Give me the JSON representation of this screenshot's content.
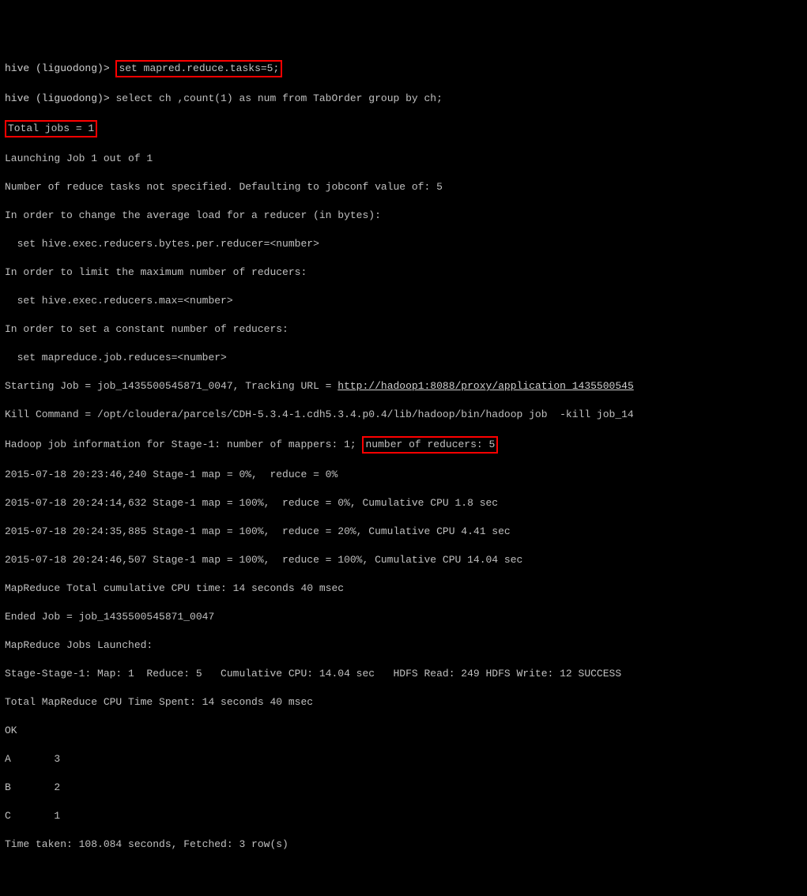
{
  "prompt": "hive (liguodong)>",
  "cmd1": "set mapred.reduce.tasks=5;",
  "cmd2": "select ch ,count(1) as num from TabOrder group by ch;",
  "total_jobs": "Total jobs = 1",
  "lines": {
    "launch": "Launching Job 1 out of 1",
    "nspec": "Number of reduce tasks not specified. Defaulting to jobconf value of: 5",
    "avg": "In order to change the average load for a reducer (in bytes):",
    "avg2": "  set hive.exec.reducers.bytes.per.reducer=<number>",
    "lim": "In order to limit the maximum number of reducers:",
    "lim2": "  set hive.exec.reducers.max=<number>",
    "const": "In order to set a constant number of reducers:",
    "const2": "  set mapreduce.job.reduces=<number>",
    "startjob_pre": "Starting Job = job_1435500545871_0047, Tracking URL = ",
    "tracking_url": "http://hadoop1:8088/proxy/application_1435500545",
    "kill": "Kill Command = /opt/cloudera/parcels/CDH-5.3.4-1.cdh5.3.4.p0.4/lib/hadoop/bin/hadoop job  -kill job_14",
    "jobinfo_pre": "Hadoop job information for Stage-1: number of mappers: 1; ",
    "reducers_box": "number of reducers: 5",
    "p0": "2015-07-18 20:23:46,240 Stage-1 map = 0%,  reduce = 0%",
    "p1": "2015-07-18 20:24:14,632 Stage-1 map = 100%,  reduce = 0%, Cumulative CPU 1.8 sec",
    "p2": "2015-07-18 20:24:35,885 Stage-1 map = 100%,  reduce = 20%, Cumulative CPU 4.41 sec",
    "p3": "2015-07-18 20:24:46,507 Stage-1 map = 100%,  reduce = 100%, Cumulative CPU 14.04 sec",
    "cpu_total": "MapReduce Total cumulative CPU time: 14 seconds 40 msec",
    "ended": "Ended Job = job_1435500545871_0047",
    "mr_launched": "MapReduce Jobs Launched:",
    "stage_stats": "Stage-Stage-1: Map: 1  Reduce: 5   Cumulative CPU: 14.04 sec   HDFS Read: 249 HDFS Write: 12 SUCCESS",
    "cpu_spent": "Total MapReduce CPU Time Spent: 14 seconds 40 msec",
    "ok": "OK",
    "time_taken": "Time taken: 108.084 seconds, Fetched: 3 row(s)"
  },
  "results": [
    {
      "ch": "A",
      "num": "3"
    },
    {
      "ch": "B",
      "num": "2"
    },
    {
      "ch": "C",
      "num": "1"
    }
  ],
  "chart_data": {
    "type": "table",
    "columns": [
      "ch",
      "num"
    ],
    "rows": [
      [
        "A",
        3
      ],
      [
        "B",
        2
      ],
      [
        "C",
        1
      ]
    ]
  }
}
